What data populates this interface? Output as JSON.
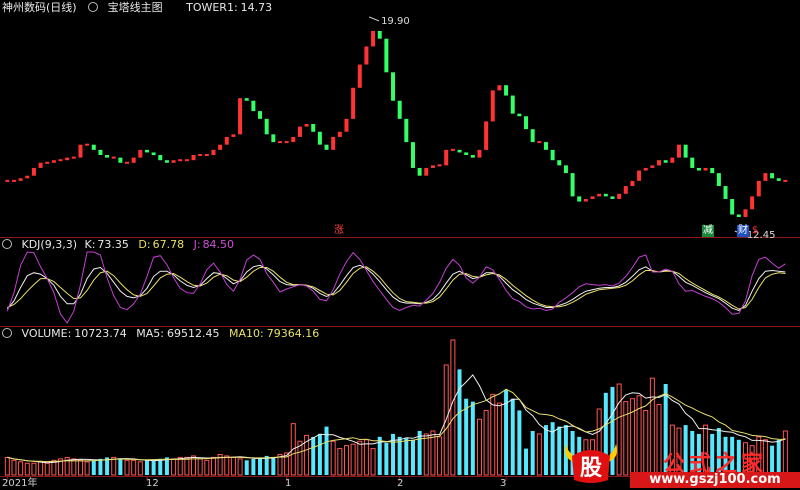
{
  "main_header": {
    "stock": "神州数码(日线)",
    "indicator": "宝塔线主图",
    "tower_label": "TOWER1:",
    "tower_value": "14.73"
  },
  "main_chart": {
    "high_label": "19.90",
    "low_label": "12.45",
    "markers": {
      "rise": "涨",
      "reduce": "减",
      "finance": "财",
      "extra": "$"
    },
    "colors": {
      "up": "#ff3333",
      "down": "#33ff66",
      "flat": "#e0e0e0"
    }
  },
  "kdj_header": {
    "name": "KDJ(9,3,3)",
    "k_label": "K:",
    "k_value": "73.35",
    "d_label": "D:",
    "d_value": "67.78",
    "j_label": "J:",
    "j_value": "84.50"
  },
  "volume_header": {
    "name": "VOLUME:",
    "volume_value": "10723.74",
    "ma5_label": "MA5:",
    "ma5_value": "69512.45",
    "ma10_label": "MA10:",
    "ma10_value": "79364.16"
  },
  "x_axis": {
    "labels": [
      "2021年",
      "12",
      "1",
      "2",
      "3"
    ]
  },
  "watermark": {
    "logo": "股",
    "title": "公式之家",
    "url": "www.gszj100.com"
  },
  "chart_data": [
    {
      "type": "candlestick",
      "name": "宝塔线主图",
      "values": [
        14.1,
        14.1,
        14.2,
        14.3,
        14.6,
        14.8,
        14.8,
        14.9,
        14.9,
        15.0,
        15.0,
        15.5,
        15.5,
        15.3,
        15.1,
        15.0,
        15.0,
        14.8,
        14.8,
        15.0,
        15.3,
        15.2,
        15.1,
        14.9,
        14.8,
        14.9,
        14.9,
        14.9,
        15.1,
        15.1,
        15.1,
        15.3,
        15.5,
        15.8,
        15.9,
        17.3,
        17.2,
        16.8,
        16.5,
        15.9,
        15.6,
        15.6,
        15.6,
        15.8,
        16.2,
        16.3,
        16.0,
        15.5,
        15.3,
        15.8,
        16.0,
        16.5,
        17.7,
        18.6,
        19.3,
        19.9,
        19.6,
        18.3,
        17.2,
        16.5,
        15.6,
        14.6,
        14.3,
        14.6,
        14.7,
        14.7,
        15.3,
        15.3,
        15.2,
        15.1,
        15.0,
        15.3,
        16.4,
        17.6,
        17.8,
        17.4,
        16.7,
        16.6,
        16.1,
        15.6,
        15.6,
        15.3,
        14.9,
        14.7,
        14.4,
        13.5,
        13.3,
        13.4,
        13.5,
        13.6,
        13.5,
        13.4,
        13.6,
        13.9,
        14.1,
        14.5,
        14.6,
        14.7,
        14.9,
        14.8,
        15.0,
        15.5,
        15.0,
        14.6,
        14.5,
        14.6,
        14.4,
        13.9,
        13.4,
        12.8,
        12.7,
        13.0,
        13.5,
        14.1,
        14.4,
        14.2,
        14.1,
        14.1
      ]
    },
    {
      "type": "line",
      "name": "KDJ(9,3,3)",
      "series": [
        {
          "name": "K",
          "values": [
            23,
            34,
            52,
            68,
            72,
            70,
            64,
            55,
            40,
            30,
            30,
            43,
            64,
            77,
            79,
            71,
            59,
            47,
            40,
            38,
            41,
            51,
            67,
            74,
            74,
            69,
            61,
            55,
            52,
            55,
            64,
            72,
            71,
            64,
            57,
            61,
            73,
            80,
            82,
            77,
            69,
            60,
            56,
            55,
            56,
            55,
            51,
            44,
            40,
            44,
            55,
            68,
            79,
            82,
            78,
            70,
            60,
            49,
            39,
            33,
            31,
            31,
            30,
            32,
            36,
            45,
            58,
            70,
            74,
            69,
            64,
            66,
            72,
            72,
            67,
            58,
            49,
            43,
            36,
            31,
            28,
            25,
            25,
            28,
            31,
            36,
            42,
            47,
            49,
            51,
            52,
            52,
            54,
            59,
            67,
            76,
            80,
            74,
            73,
            75,
            74,
            67,
            59,
            55,
            50,
            45,
            41,
            37,
            31,
            24,
            21,
            28,
            47,
            64,
            74,
            75,
            74,
            73
          ]
        },
        {
          "name": "D",
          "values": [
            25,
            29,
            37,
            47,
            56,
            64,
            64,
            60,
            52,
            44,
            37,
            38,
            48,
            62,
            72,
            74,
            68,
            58,
            49,
            42,
            40,
            44,
            54,
            65,
            70,
            71,
            66,
            60,
            55,
            54,
            58,
            66,
            70,
            68,
            62,
            60,
            66,
            74,
            79,
            79,
            74,
            66,
            59,
            56,
            56,
            55,
            53,
            48,
            43,
            42,
            48,
            59,
            71,
            78,
            80,
            74,
            66,
            55,
            45,
            37,
            33,
            32,
            31,
            31,
            33,
            39,
            50,
            62,
            70,
            71,
            67,
            66,
            69,
            71,
            69,
            63,
            55,
            48,
            41,
            35,
            30,
            27,
            26,
            26,
            28,
            32,
            37,
            43,
            46,
            49,
            50,
            51,
            52,
            55,
            61,
            69,
            75,
            75,
            73,
            74,
            74,
            71,
            64,
            58,
            53,
            48,
            43,
            39,
            34,
            28,
            23,
            25,
            36,
            52,
            65,
            70,
            72,
            71
          ]
        },
        {
          "name": "J",
          "values": [
            20,
            45,
            82,
            100,
            99,
            80,
            64,
            45,
            16,
            4,
            20,
            56,
            100,
            100,
            96,
            65,
            41,
            25,
            22,
            30,
            43,
            67,
            93,
            95,
            83,
            65,
            51,
            45,
            44,
            57,
            76,
            85,
            73,
            56,
            47,
            63,
            89,
            96,
            90,
            71,
            59,
            46,
            50,
            53,
            56,
            54,
            47,
            36,
            34,
            49,
            70,
            87,
            99,
            90,
            75,
            60,
            48,
            36,
            25,
            21,
            25,
            28,
            27,
            35,
            44,
            59,
            78,
            90,
            82,
            65,
            58,
            66,
            80,
            76,
            63,
            48,
            37,
            33,
            26,
            23,
            24,
            21,
            23,
            32,
            38,
            45,
            53,
            57,
            56,
            55,
            56,
            54,
            58,
            67,
            79,
            93,
            96,
            73,
            73,
            77,
            74,
            57,
            47,
            48,
            44,
            40,
            37,
            32,
            25,
            16,
            17,
            34,
            68,
            90,
            93,
            85,
            78,
            84
          ]
        }
      ],
      "ylim": [
        0,
        100
      ]
    },
    {
      "type": "bar",
      "name": "VOLUME",
      "values": [
        12,
        10,
        9,
        8,
        8,
        9,
        8,
        10,
        11,
        12,
        11,
        10,
        9,
        10,
        11,
        12,
        12,
        11,
        10,
        10,
        9,
        10,
        10,
        11,
        12,
        11,
        12,
        12,
        13,
        11,
        10,
        12,
        14,
        13,
        12,
        11,
        10,
        11,
        12,
        13,
        12,
        14,
        15,
        35,
        23,
        27,
        26,
        28,
        33,
        23,
        18,
        20,
        21,
        23,
        24,
        18,
        26,
        22,
        28,
        26,
        25,
        24,
        30,
        28,
        30,
        26,
        75,
        92,
        72,
        52,
        50,
        38,
        44,
        55,
        49,
        58,
        52,
        44,
        18,
        30,
        28,
        34,
        36,
        33,
        34,
        30,
        26,
        24,
        24,
        45,
        56,
        60,
        62,
        50,
        52,
        54,
        44,
        66,
        48,
        62,
        34,
        32,
        34,
        30,
        28,
        34,
        28,
        32,
        26,
        26,
        24,
        22,
        20,
        26,
        24,
        20,
        24,
        30
      ],
      "colors": [
        "#ff5555",
        "#55e8ff"
      ]
    }
  ]
}
